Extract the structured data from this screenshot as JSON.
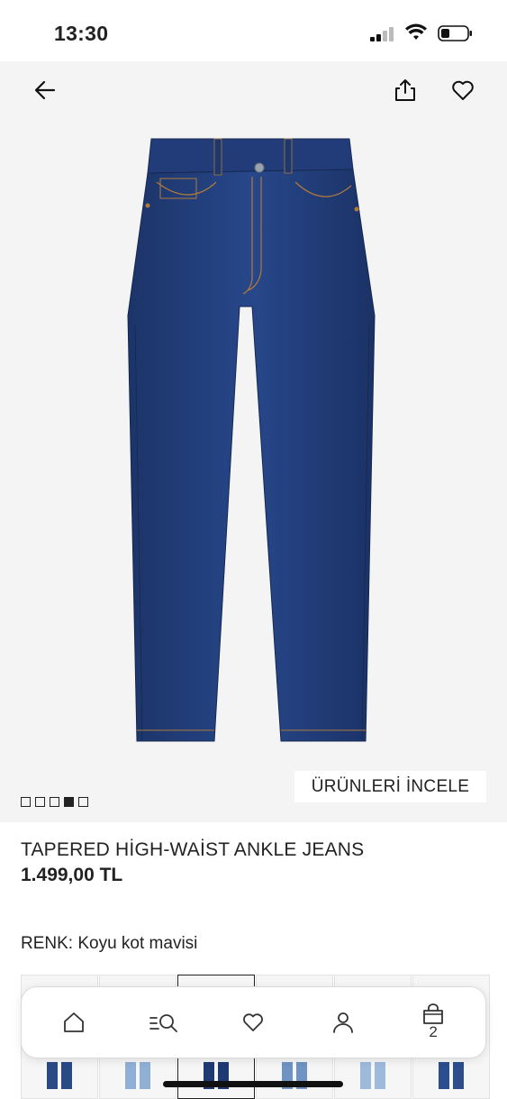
{
  "status_bar": {
    "time": "13:30"
  },
  "product": {
    "name": "TAPERED HİGH-WAİST ANKLE JEANS",
    "price": "1.499,00 TL",
    "inspect_label": "ÜRÜNLERİ İNCELE",
    "image_count": 5,
    "active_image_index": 3
  },
  "color": {
    "label": "RENK: Koyu kot mavisi",
    "swatches": [
      "dark-denim",
      "light-denim",
      "selected-dark-denim",
      "mid-denim",
      "light-denim-2",
      "dark-denim-2"
    ],
    "selected_index": 2
  },
  "bottom_nav": {
    "items": [
      {
        "icon": "home-icon"
      },
      {
        "icon": "search-icon"
      },
      {
        "icon": "heart-icon"
      },
      {
        "icon": "profile-icon"
      },
      {
        "icon": "bag-icon",
        "badge": "2"
      }
    ]
  },
  "colors": {
    "denim_dark": "#1f3a73",
    "denim_mid": "#2b4f8f",
    "denim_light": "#8fb0d4",
    "text": "#222222",
    "image_bg": "#f4f4f4"
  }
}
